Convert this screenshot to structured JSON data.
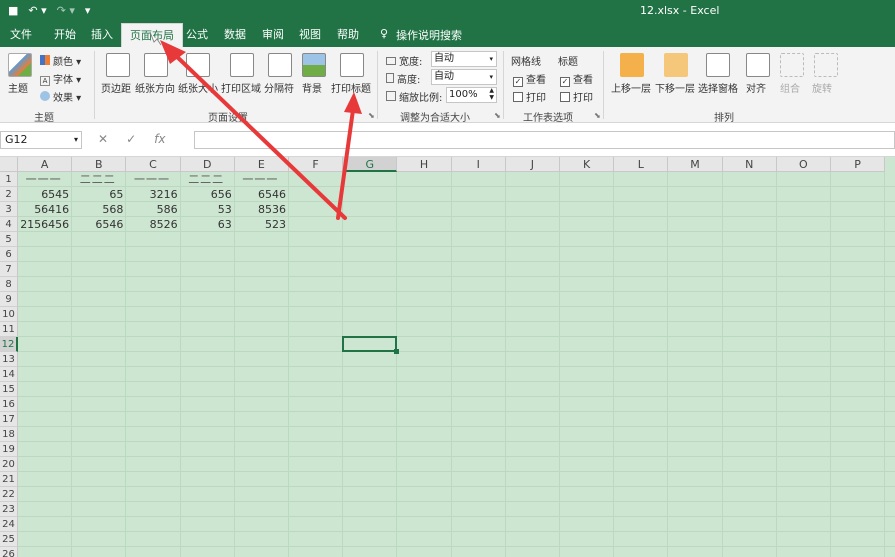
{
  "titlebar": {
    "title": "12.xlsx  -  Excel",
    "qat": [
      {
        "name": "save-icon",
        "glyph": "■"
      },
      {
        "name": "undo-icon",
        "glyph": "↶ ▾"
      },
      {
        "name": "redo-icon",
        "glyph": "↷ ▾"
      },
      {
        "name": "customize-qat-icon",
        "glyph": "▾"
      }
    ]
  },
  "tabs": [
    "文件",
    "开始",
    "插入",
    "页面布局",
    "公式",
    "数据",
    "审阅",
    "视图",
    "帮助"
  ],
  "tell_me": {
    "icon": "lightbulb-icon",
    "text": "操作说明搜索"
  },
  "ribbon": {
    "theme": {
      "theme_label": "主题",
      "colors": "颜色",
      "fonts": "字体",
      "effects": "效果",
      "group": "主题"
    },
    "page_setup": {
      "margins": "页边距",
      "orientation": "纸张方向",
      "size": "纸张大小",
      "print_area": "打印区域",
      "breaks": "分隔符",
      "background": "背景",
      "print_titles": "打印标题",
      "group": "页面设置"
    },
    "scale": {
      "width_label": "宽度:",
      "width_value": "自动",
      "height_label": "高度:",
      "height_value": "自动",
      "scale_label": "缩放比例:",
      "scale_value": "100%",
      "group": "调整为合适大小"
    },
    "sheet_options": {
      "gridlines": "网格线",
      "headings": "标题",
      "view": "查看",
      "print": "打印",
      "group": "工作表选项"
    },
    "arrange": {
      "bring_forward": "上移一层",
      "send_backward": "下移一层",
      "selection_pane": "选择窗格",
      "align": "对齐",
      "group_btn": "组合",
      "rotate": "旋转",
      "group": "排列"
    }
  },
  "formula_bar": {
    "name_box": "G12",
    "fx": "fx",
    "cancel": "✕",
    "enter": "✓",
    "formula": ""
  },
  "sheet": {
    "columns": [
      "A",
      "B",
      "C",
      "D",
      "E",
      "F",
      "G",
      "H",
      "I",
      "J",
      "K",
      "L",
      "M",
      "N",
      "O",
      "P"
    ],
    "rows": [
      "1",
      "2",
      "3",
      "4",
      "5",
      "6",
      "7",
      "8",
      "9",
      "10",
      "11",
      "12",
      "13",
      "14",
      "15",
      "16",
      "17",
      "18",
      "19",
      "20",
      "21",
      "22",
      "23",
      "24",
      "25",
      "26"
    ],
    "selected_cell": "G12",
    "header_row": [
      "一一一",
      "二二二",
      "一一一",
      "二二二",
      "一一一"
    ],
    "data": [
      [
        "6545",
        "65",
        "3216",
        "656",
        "6546"
      ],
      [
        "56416",
        "568",
        "586",
        "53",
        "8536"
      ],
      [
        "2156456",
        "6546",
        "8526",
        "63",
        "523"
      ]
    ]
  },
  "colors": {
    "accent": "#217346",
    "sheet_bg": "#cde6d1",
    "arrow": "#e8393a"
  }
}
